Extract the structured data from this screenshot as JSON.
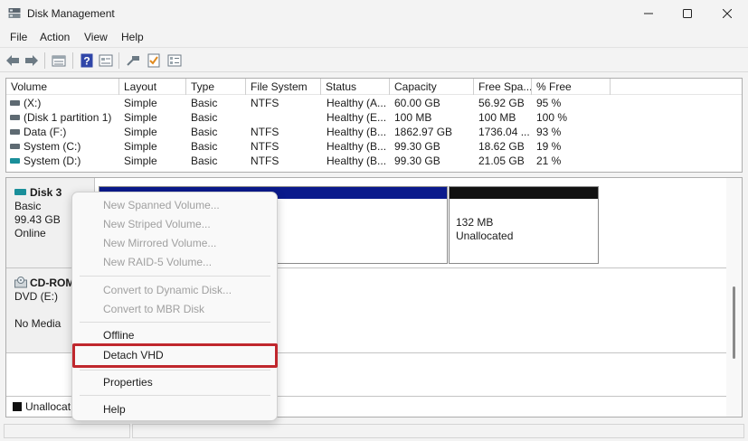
{
  "window": {
    "title": "Disk Management",
    "app_icon": "disk-management-icon",
    "controls": [
      "minimize-icon",
      "maximize-icon",
      "close-icon"
    ]
  },
  "menubar": {
    "items": [
      "File",
      "Action",
      "View",
      "Help"
    ]
  },
  "toolbar": {
    "icons": [
      "back-arrow-icon",
      "forward-arrow-icon",
      "disk-list-icon",
      "help-icon",
      "properties-icon",
      "connect-icon",
      "checklist-icon",
      "settings-list-icon"
    ]
  },
  "volumes": {
    "columns": [
      "Volume",
      "Layout",
      "Type",
      "File System",
      "Status",
      "Capacity",
      "Free Spa...",
      "% Free"
    ],
    "rows": [
      {
        "volume": " (X:)",
        "layout": "Simple",
        "type": "Basic",
        "fs": "NTFS",
        "status": "Healthy (A...",
        "capacity": "60.00 GB",
        "free": "56.92 GB",
        "pct": "95 %",
        "icon": "drive-icon"
      },
      {
        "volume": "(Disk 1 partition 1)",
        "layout": "Simple",
        "type": "Basic",
        "fs": "",
        "status": "Healthy (E...",
        "capacity": "100 MB",
        "free": "100 MB",
        "pct": "100 %",
        "icon": "drive-icon"
      },
      {
        "volume": "Data (F:)",
        "layout": "Simple",
        "type": "Basic",
        "fs": "NTFS",
        "status": "Healthy (B...",
        "capacity": "1862.97 GB",
        "free": "1736.04 ...",
        "pct": "93 %",
        "icon": "drive-icon"
      },
      {
        "volume": "System (C:)",
        "layout": "Simple",
        "type": "Basic",
        "fs": "NTFS",
        "status": "Healthy (B...",
        "capacity": "99.30 GB",
        "free": "18.62 GB",
        "pct": "19 %",
        "icon": "drive-icon"
      },
      {
        "volume": "System (D:)",
        "layout": "Simple",
        "type": "Basic",
        "fs": "NTFS",
        "status": "Healthy (B...",
        "capacity": "99.30 GB",
        "free": "21.05 GB",
        "pct": "21 %",
        "icon": "vhd-drive-icon"
      }
    ]
  },
  "disks": {
    "disk3": {
      "name": "Disk 3",
      "type": "Basic",
      "size": "99.43 GB",
      "status": "Online",
      "unallocated_size": "132 MB",
      "unallocated_label": "Unallocated",
      "primary_color": "#0a1a8c",
      "unallocated_color": "#111111"
    },
    "cdrom": {
      "name": "CD-ROM",
      "drive": "DVD (E:)",
      "media": "No Media"
    }
  },
  "legend": {
    "label": "Unallocat"
  },
  "context_menu": {
    "group1": [
      "New Spanned Volume...",
      "New Striped Volume...",
      "New Mirrored Volume...",
      "New RAID-5 Volume..."
    ],
    "group2": [
      "Convert to Dynamic Disk...",
      "Convert to MBR Disk"
    ],
    "offline": "Offline",
    "detach": "Detach VHD",
    "properties": "Properties",
    "help": "Help",
    "highlight_color": "#c0272d"
  }
}
